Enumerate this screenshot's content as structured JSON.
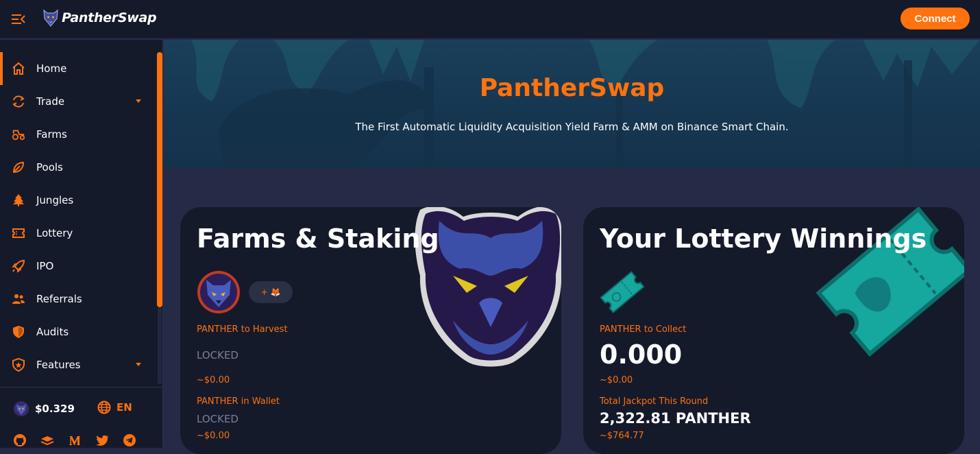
{
  "header": {
    "brand": "PantherSwap",
    "connect_label": "Connect"
  },
  "sidebar": {
    "items": [
      {
        "label": "Home",
        "icon": "home-icon"
      },
      {
        "label": "Trade",
        "icon": "trade-icon"
      },
      {
        "label": "Farms",
        "icon": "tractor-icon"
      },
      {
        "label": "Pools",
        "icon": "leaf-icon"
      },
      {
        "label": "Jungles",
        "icon": "tree-icon"
      },
      {
        "label": "Lottery",
        "icon": "ticket-icon"
      },
      {
        "label": "IPO",
        "icon": "rocket-icon"
      },
      {
        "label": "Referrals",
        "icon": "people-icon"
      },
      {
        "label": "Audits",
        "icon": "shield-icon"
      },
      {
        "label": "Features",
        "icon": "star-shield-icon"
      }
    ],
    "price": "$0.329",
    "language": "EN"
  },
  "hero": {
    "title": "PantherSwap",
    "subtitle": "The First Automatic Liquidity Acquisition Yield Farm & AMM on Binance Smart Chain."
  },
  "farms_card": {
    "title": "Farms & Staking",
    "add_token_label": "+ 🦊",
    "harvest_label": "PANTHER to Harvest",
    "harvest_value": "LOCKED",
    "harvest_usd": "~$0.00",
    "wallet_label": "PANTHER in Wallet",
    "wallet_value": "LOCKED",
    "wallet_usd": "~$0.00"
  },
  "lottery_card": {
    "title": "Your Lottery Winnings",
    "collect_label": "PANTHER to Collect",
    "collect_value": "0.000",
    "collect_usd": "~$0.00",
    "jackpot_label": "Total Jackpot This Round",
    "jackpot_value": "2,322.81 PANTHER",
    "jackpot_usd": "~$764.77"
  },
  "colors": {
    "accent": "#ff720d",
    "background": "#252a47",
    "panel": "#151a2b",
    "hero": "#163650",
    "teal": "#16a79e"
  }
}
